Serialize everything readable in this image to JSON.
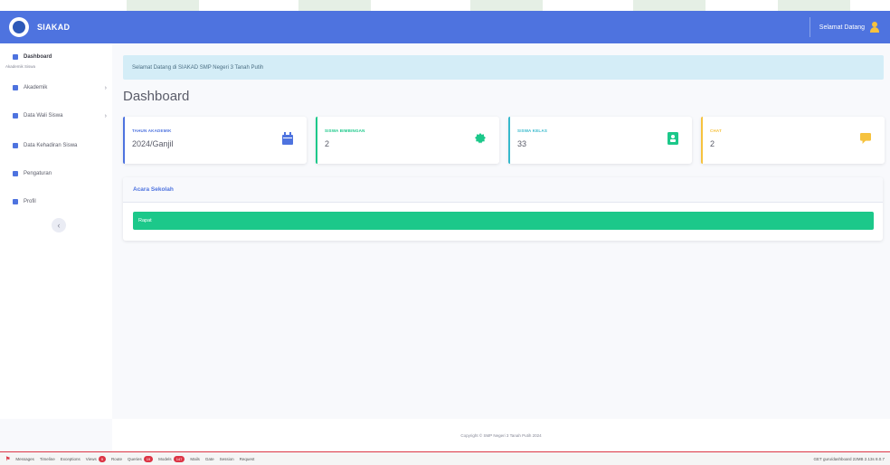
{
  "topbar": {
    "brand": "SIAKAD",
    "user_name": "Selamat Datang"
  },
  "sidebar": {
    "items": [
      {
        "label": "Dashboard",
        "icon": "gauge-icon"
      },
      {
        "label": "Akademik",
        "icon": "table-icon"
      },
      {
        "label": "Data Wali Siswa",
        "icon": "user-icon"
      },
      {
        "label": "Data Kehadiran Siswa",
        "icon": "table-icon"
      },
      {
        "label": "Pengaturan",
        "icon": "users-icon"
      },
      {
        "label": "Profil",
        "icon": "user-icon"
      }
    ],
    "sub_label": "Akademik Siswa",
    "chevron": "›",
    "toggle": "‹"
  },
  "welcome_text": "Selamat Datang di SIAKAD SMP Negeri 3 Tanah Putih",
  "page_title": "Dashboard",
  "cards": [
    {
      "label": "Tahun Akademik",
      "value": "2024/Ganjil",
      "color": "#4e73df",
      "icon": "calendar-icon"
    },
    {
      "label": "Siswa Bimbingan",
      "value": "2",
      "color": "#1cc88a",
      "icon": "badge-icon"
    },
    {
      "label": "Siswa Kelas",
      "value": "33",
      "color": "#36b9cc",
      "icon": "contact-icon"
    },
    {
      "label": "Chat",
      "value": "2",
      "color": "#f6c23e",
      "icon": "comment-icon"
    }
  ],
  "panel": {
    "title": "Acara Sekolah",
    "bar_text": "Rapat"
  },
  "footer": "Copyright © SMP Negeri 3 Tanah Putih 2024",
  "debugbar": {
    "tabs": [
      {
        "label": "Messages",
        "badge": ""
      },
      {
        "label": "Timeline",
        "badge": ""
      },
      {
        "label": "Exceptions",
        "badge": ""
      },
      {
        "label": "Views",
        "badge": "9"
      },
      {
        "label": "Route",
        "badge": ""
      },
      {
        "label": "Queries",
        "badge": "19"
      },
      {
        "label": "Models",
        "badge": "147"
      },
      {
        "label": "Mails",
        "badge": ""
      },
      {
        "label": "Gate",
        "badge": ""
      },
      {
        "label": "Session",
        "badge": ""
      },
      {
        "label": "Request",
        "badge": ""
      }
    ],
    "right": "GET guru/dashboard  22MB  2.13s  8.0.7"
  }
}
